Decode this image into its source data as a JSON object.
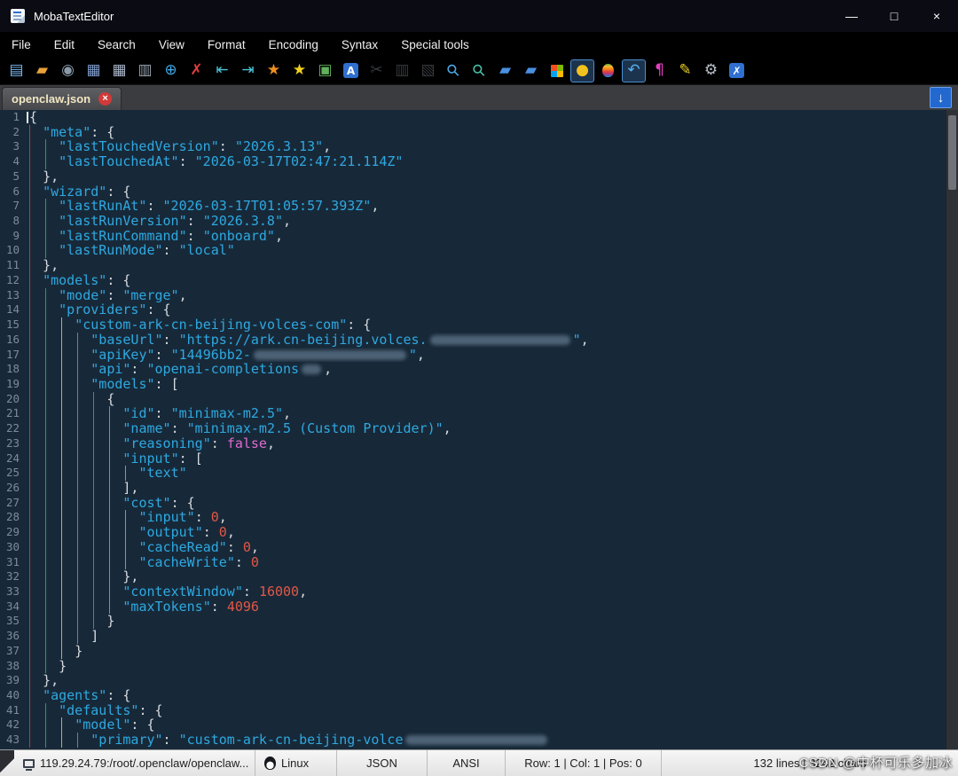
{
  "window": {
    "title": "MobaTextEditor",
    "controls": [
      {
        "name": "minimize-button",
        "glyph": "—"
      },
      {
        "name": "maximize-button",
        "glyph": "□"
      },
      {
        "name": "close-button",
        "glyph": "×"
      }
    ]
  },
  "menu": {
    "items": [
      "File",
      "Edit",
      "Search",
      "View",
      "Format",
      "Encoding",
      "Syntax",
      "Special tools"
    ]
  },
  "toolbar": {
    "icons": [
      {
        "name": "new-file-icon",
        "glyph": "▤",
        "color": "#79b8f3"
      },
      {
        "name": "open-folder-icon",
        "glyph": "▰",
        "color": "#e8a23a"
      },
      {
        "name": "record-icon",
        "glyph": "◉",
        "color": "#8a9aa8"
      },
      {
        "name": "save-icon",
        "glyph": "▦",
        "color": "#7f9ccb"
      },
      {
        "name": "save-all-icon",
        "glyph": "▦",
        "color": "#a9b6c9"
      },
      {
        "name": "print-icon",
        "glyph": "▥",
        "color": "#9aa6b2"
      },
      {
        "name": "globe-icon",
        "glyph": "⊕",
        "color": "#3fa9e8"
      },
      {
        "name": "close-file-icon",
        "glyph": "✗",
        "color": "#e23c3c"
      },
      {
        "name": "outdent-icon",
        "glyph": "⇤",
        "color": "#49c4d8"
      },
      {
        "name": "indent-icon",
        "glyph": "⇥",
        "color": "#49c4d8"
      },
      {
        "name": "star-orange-icon",
        "glyph": "★",
        "color": "#ef8f1f"
      },
      {
        "name": "star-yellow-icon",
        "glyph": "★",
        "color": "#f2d01f"
      },
      {
        "name": "screenshot-icon",
        "glyph": "▣",
        "color": "#62b05e"
      },
      {
        "name": "font-icon",
        "glyph": "A",
        "color": "#ffffff",
        "bg": "#2f6fd0"
      },
      {
        "name": "cut-icon",
        "glyph": "✂",
        "color": "#8a919c",
        "state": "disabled"
      },
      {
        "name": "copy-icon",
        "glyph": "▥",
        "color": "#8a919c",
        "state": "disabled"
      },
      {
        "name": "paste-icon",
        "glyph": "▧",
        "color": "#8a919c",
        "state": "disabled"
      },
      {
        "name": "search-icon",
        "glyph": "⚲",
        "color": "#4aa8e8"
      },
      {
        "name": "replace-icon",
        "glyph": "⚲",
        "color": "#48c0a8"
      },
      {
        "name": "prev-doc-icon",
        "glyph": "▰",
        "color": "#4a90e2"
      },
      {
        "name": "next-doc-icon",
        "glyph": "▰",
        "color": "#4a90e2"
      },
      {
        "name": "windows-icon",
        "glyph": "",
        "color": "#ffffff"
      },
      {
        "name": "penguin-icon",
        "glyph": "●",
        "color": "#f2c21f",
        "state": "active"
      },
      {
        "name": "apple-icon",
        "glyph": "",
        "color": "#ffffff"
      },
      {
        "name": "undo-icon",
        "glyph": "↶",
        "color": "#5ab0f0",
        "state": "active"
      },
      {
        "name": "pilcrow-icon",
        "glyph": "¶",
        "color": "#e040c0"
      },
      {
        "name": "pencil-icon",
        "glyph": "✎",
        "color": "#e8d020"
      },
      {
        "name": "settings-icon",
        "glyph": "⚙",
        "color": "#b8c0c8"
      },
      {
        "name": "blue-close-icon",
        "glyph": "✗",
        "color": "#ffffff",
        "bg": "#2f6fd0"
      }
    ]
  },
  "tabbar": {
    "active_tab": "openclaw.json",
    "close_glyph": "×",
    "scroll_button_glyph": "↓"
  },
  "editor": {
    "guide_colors": [
      "#c0392b",
      "#2e9e44",
      "#c8b22e",
      "#c04fc0",
      "#3f7fd4",
      "#2eb4b4",
      "#d4823f"
    ],
    "lines": [
      {
        "n": 1,
        "i": 0,
        "caret": true,
        "t": [
          [
            "p",
            "{"
          ]
        ]
      },
      {
        "n": 2,
        "i": 2,
        "t": [
          [
            "s",
            "\"meta\""
          ],
          [
            "p",
            ": {"
          ]
        ]
      },
      {
        "n": 3,
        "i": 4,
        "t": [
          [
            "s",
            "\"lastTouchedVersion\""
          ],
          [
            "p",
            ": "
          ],
          [
            "s",
            "\"2026.3.13\""
          ],
          [
            "p",
            ","
          ]
        ]
      },
      {
        "n": 4,
        "i": 4,
        "t": [
          [
            "s",
            "\"lastTouchedAt\""
          ],
          [
            "p",
            ": "
          ],
          [
            "s",
            "\"2026-03-17T02:47:21.114Z\""
          ]
        ]
      },
      {
        "n": 5,
        "i": 2,
        "t": [
          [
            "p",
            "},"
          ]
        ]
      },
      {
        "n": 6,
        "i": 2,
        "t": [
          [
            "s",
            "\"wizard\""
          ],
          [
            "p",
            ": {"
          ]
        ]
      },
      {
        "n": 7,
        "i": 4,
        "t": [
          [
            "s",
            "\"lastRunAt\""
          ],
          [
            "p",
            ": "
          ],
          [
            "s",
            "\"2026-03-17T01:05:57.393Z\""
          ],
          [
            "p",
            ","
          ]
        ]
      },
      {
        "n": 8,
        "i": 4,
        "t": [
          [
            "s",
            "\"lastRunVersion\""
          ],
          [
            "p",
            ": "
          ],
          [
            "s",
            "\"2026.3.8\""
          ],
          [
            "p",
            ","
          ]
        ]
      },
      {
        "n": 9,
        "i": 4,
        "t": [
          [
            "s",
            "\"lastRunCommand\""
          ],
          [
            "p",
            ": "
          ],
          [
            "s",
            "\"onboard\""
          ],
          [
            "p",
            ","
          ]
        ]
      },
      {
        "n": 10,
        "i": 4,
        "t": [
          [
            "s",
            "\"lastRunMode\""
          ],
          [
            "p",
            ": "
          ],
          [
            "s",
            "\"local\""
          ]
        ]
      },
      {
        "n": 11,
        "i": 2,
        "t": [
          [
            "p",
            "},"
          ]
        ]
      },
      {
        "n": 12,
        "i": 2,
        "t": [
          [
            "s",
            "\"models\""
          ],
          [
            "p",
            ": {"
          ]
        ]
      },
      {
        "n": 13,
        "i": 4,
        "t": [
          [
            "s",
            "\"mode\""
          ],
          [
            "p",
            ": "
          ],
          [
            "s",
            "\"merge\""
          ],
          [
            "p",
            ","
          ]
        ]
      },
      {
        "n": 14,
        "i": 4,
        "t": [
          [
            "s",
            "\"providers\""
          ],
          [
            "p",
            ": {"
          ]
        ]
      },
      {
        "n": 15,
        "i": 6,
        "t": [
          [
            "s",
            "\"custom-ark-cn-beijing-volces-com\""
          ],
          [
            "p",
            ": {"
          ]
        ]
      },
      {
        "n": 16,
        "i": 8,
        "t": [
          [
            "s",
            "\"baseUrl\""
          ],
          [
            "p",
            ": "
          ],
          [
            "s",
            "\"https://ark.cn-beijing.volces."
          ],
          [
            "r",
            158
          ],
          [
            "s",
            "\""
          ],
          [
            "p",
            ","
          ]
        ]
      },
      {
        "n": 17,
        "i": 8,
        "t": [
          [
            "s",
            "\"apiKey\""
          ],
          [
            "p",
            ": "
          ],
          [
            "s",
            "\"14496bb2-"
          ],
          [
            "r",
            172
          ],
          [
            "s",
            "\""
          ],
          [
            "p",
            ","
          ]
        ]
      },
      {
        "n": 18,
        "i": 8,
        "t": [
          [
            "s",
            "\"api\""
          ],
          [
            "p",
            ": "
          ],
          [
            "s",
            "\"openai-completions"
          ],
          [
            "r",
            22
          ],
          [
            "p",
            ","
          ]
        ]
      },
      {
        "n": 19,
        "i": 8,
        "t": [
          [
            "s",
            "\"models\""
          ],
          [
            "p",
            ": ["
          ]
        ]
      },
      {
        "n": 20,
        "i": 10,
        "t": [
          [
            "p",
            "{"
          ]
        ]
      },
      {
        "n": 21,
        "i": 12,
        "t": [
          [
            "s",
            "\"id\""
          ],
          [
            "p",
            ": "
          ],
          [
            "s",
            "\"minimax-m2.5\""
          ],
          [
            "p",
            ","
          ]
        ]
      },
      {
        "n": 22,
        "i": 12,
        "t": [
          [
            "s",
            "\"name\""
          ],
          [
            "p",
            ": "
          ],
          [
            "s",
            "\"minimax-m2.5 (Custom Provider)\""
          ],
          [
            "p",
            ","
          ]
        ]
      },
      {
        "n": 23,
        "i": 12,
        "t": [
          [
            "s",
            "\"reasoning\""
          ],
          [
            "p",
            ": "
          ],
          [
            "b",
            "false"
          ],
          [
            "p",
            ","
          ]
        ]
      },
      {
        "n": 24,
        "i": 12,
        "t": [
          [
            "s",
            "\"input\""
          ],
          [
            "p",
            ": ["
          ]
        ]
      },
      {
        "n": 25,
        "i": 14,
        "t": [
          [
            "s",
            "\"text\""
          ]
        ]
      },
      {
        "n": 26,
        "i": 12,
        "t": [
          [
            "p",
            "],"
          ]
        ]
      },
      {
        "n": 27,
        "i": 12,
        "t": [
          [
            "s",
            "\"cost\""
          ],
          [
            "p",
            ": {"
          ]
        ]
      },
      {
        "n": 28,
        "i": 14,
        "t": [
          [
            "s",
            "\"input\""
          ],
          [
            "p",
            ": "
          ],
          [
            "n",
            "0"
          ],
          [
            "p",
            ","
          ]
        ]
      },
      {
        "n": 29,
        "i": 14,
        "t": [
          [
            "s",
            "\"output\""
          ],
          [
            "p",
            ": "
          ],
          [
            "n",
            "0"
          ],
          [
            "p",
            ","
          ]
        ]
      },
      {
        "n": 30,
        "i": 14,
        "t": [
          [
            "s",
            "\"cacheRead\""
          ],
          [
            "p",
            ": "
          ],
          [
            "n",
            "0"
          ],
          [
            "p",
            ","
          ]
        ]
      },
      {
        "n": 31,
        "i": 14,
        "t": [
          [
            "s",
            "\"cacheWrite\""
          ],
          [
            "p",
            ": "
          ],
          [
            "n",
            "0"
          ]
        ]
      },
      {
        "n": 32,
        "i": 12,
        "t": [
          [
            "p",
            "},"
          ]
        ]
      },
      {
        "n": 33,
        "i": 12,
        "t": [
          [
            "s",
            "\"contextWindow\""
          ],
          [
            "p",
            ": "
          ],
          [
            "n",
            "16000"
          ],
          [
            "p",
            ","
          ]
        ]
      },
      {
        "n": 34,
        "i": 12,
        "t": [
          [
            "s",
            "\"maxTokens\""
          ],
          [
            "p",
            ": "
          ],
          [
            "n",
            "4096"
          ]
        ]
      },
      {
        "n": 35,
        "i": 10,
        "t": [
          [
            "p",
            "}"
          ]
        ]
      },
      {
        "n": 36,
        "i": 8,
        "t": [
          [
            "p",
            "]"
          ]
        ]
      },
      {
        "n": 37,
        "i": 6,
        "t": [
          [
            "p",
            "}"
          ]
        ]
      },
      {
        "n": 38,
        "i": 4,
        "t": [
          [
            "p",
            "}"
          ]
        ]
      },
      {
        "n": 39,
        "i": 2,
        "t": [
          [
            "p",
            "},"
          ]
        ]
      },
      {
        "n": 40,
        "i": 2,
        "t": [
          [
            "s",
            "\"agents\""
          ],
          [
            "p",
            ": {"
          ]
        ]
      },
      {
        "n": 41,
        "i": 4,
        "t": [
          [
            "s",
            "\"defaults\""
          ],
          [
            "p",
            ": {"
          ]
        ]
      },
      {
        "n": 42,
        "i": 6,
        "t": [
          [
            "s",
            "\"model\""
          ],
          [
            "p",
            ": {"
          ]
        ]
      },
      {
        "n": 43,
        "i": 8,
        "t": [
          [
            "s",
            "\"primary\""
          ],
          [
            "p",
            ": "
          ],
          [
            "s",
            "\"custom-ark-cn-beijing-volce"
          ],
          [
            "r",
            160
          ]
        ]
      }
    ]
  },
  "statusbar": {
    "sections": [
      {
        "name": "remote-path",
        "icon": "monitor-icon",
        "text": "119.29.24.79:/root/.openclaw/openclaw..."
      },
      {
        "name": "os-label",
        "icon": "tux-icon",
        "text": "Linux"
      },
      {
        "name": "file-type",
        "text": "JSON"
      },
      {
        "name": "encoding",
        "text": "ANSI"
      },
      {
        "name": "cursor-position",
        "text": "Row: 1 | Col: 1 | Pos: 0"
      },
      {
        "name": "document-stats",
        "text": "132 lines | 3242 chars"
      }
    ]
  },
  "watermark": {
    "text": "CSDN @中杯可乐多加冰"
  }
}
